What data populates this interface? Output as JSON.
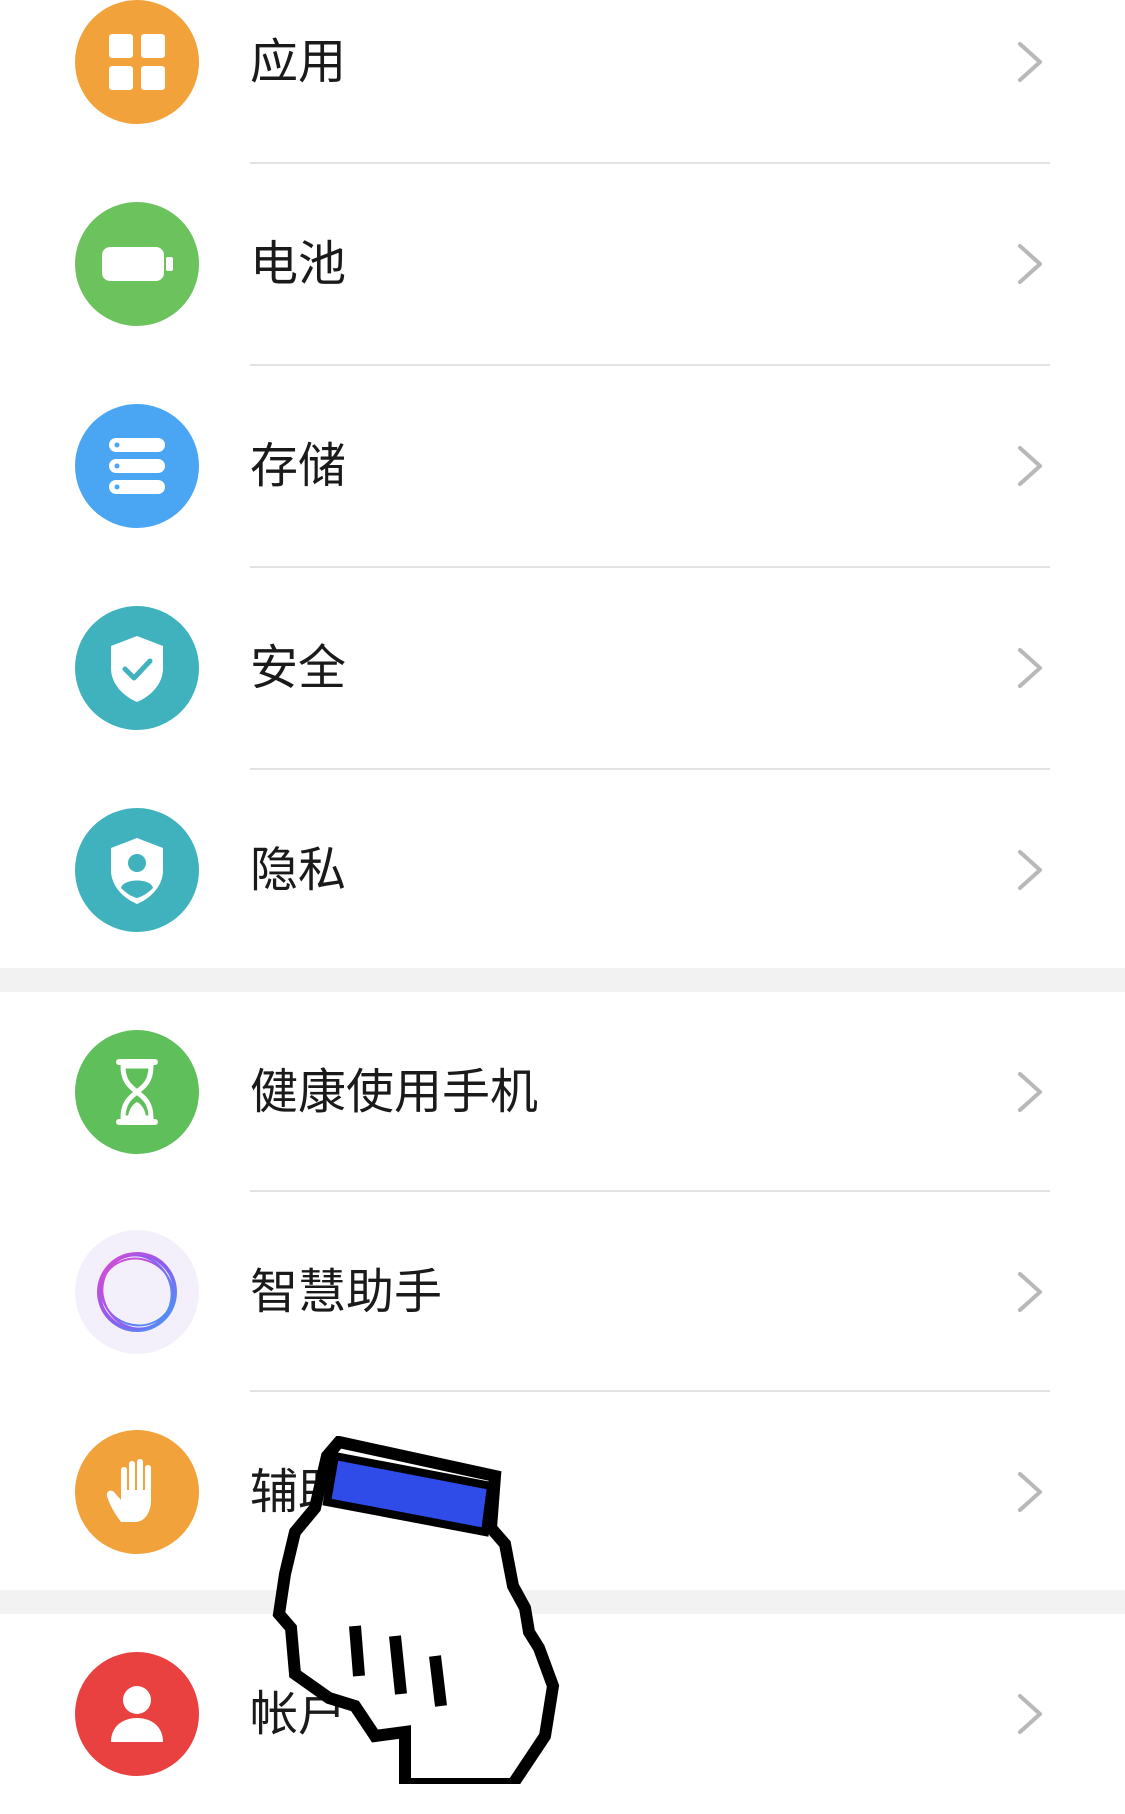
{
  "settings_groups": [
    {
      "items": [
        {
          "label": "应用",
          "icon": "apps-icon",
          "color": "#f2a23a"
        },
        {
          "label": "电池",
          "icon": "battery-icon",
          "color": "#6cc25c"
        },
        {
          "label": "存储",
          "icon": "storage-icon",
          "color": "#4aa6f2"
        },
        {
          "label": "安全",
          "icon": "security-shield-icon",
          "color": "#3fb2be"
        },
        {
          "label": "隐私",
          "icon": "privacy-shield-icon",
          "color": "#3fb2be"
        }
      ]
    },
    {
      "items": [
        {
          "label": "健康使用手机",
          "icon": "hourglass-icon",
          "color": "#5fbf5a"
        },
        {
          "label": "智慧助手",
          "icon": "assistant-orb-icon",
          "color": "#f4f0fb"
        },
        {
          "label": "辅助",
          "icon": "hand-icon",
          "color": "#f2a23a"
        }
      ]
    },
    {
      "items": [
        {
          "label": "帐户",
          "icon": "account-icon",
          "color": "#e94040"
        }
      ]
    }
  ],
  "colors": {
    "divider": "#e3e3e3",
    "group_gap": "#f2f2f2",
    "chevron": "#b8b8b8",
    "text": "#1a1a1a",
    "cursor_accent": "#2f4be8"
  }
}
